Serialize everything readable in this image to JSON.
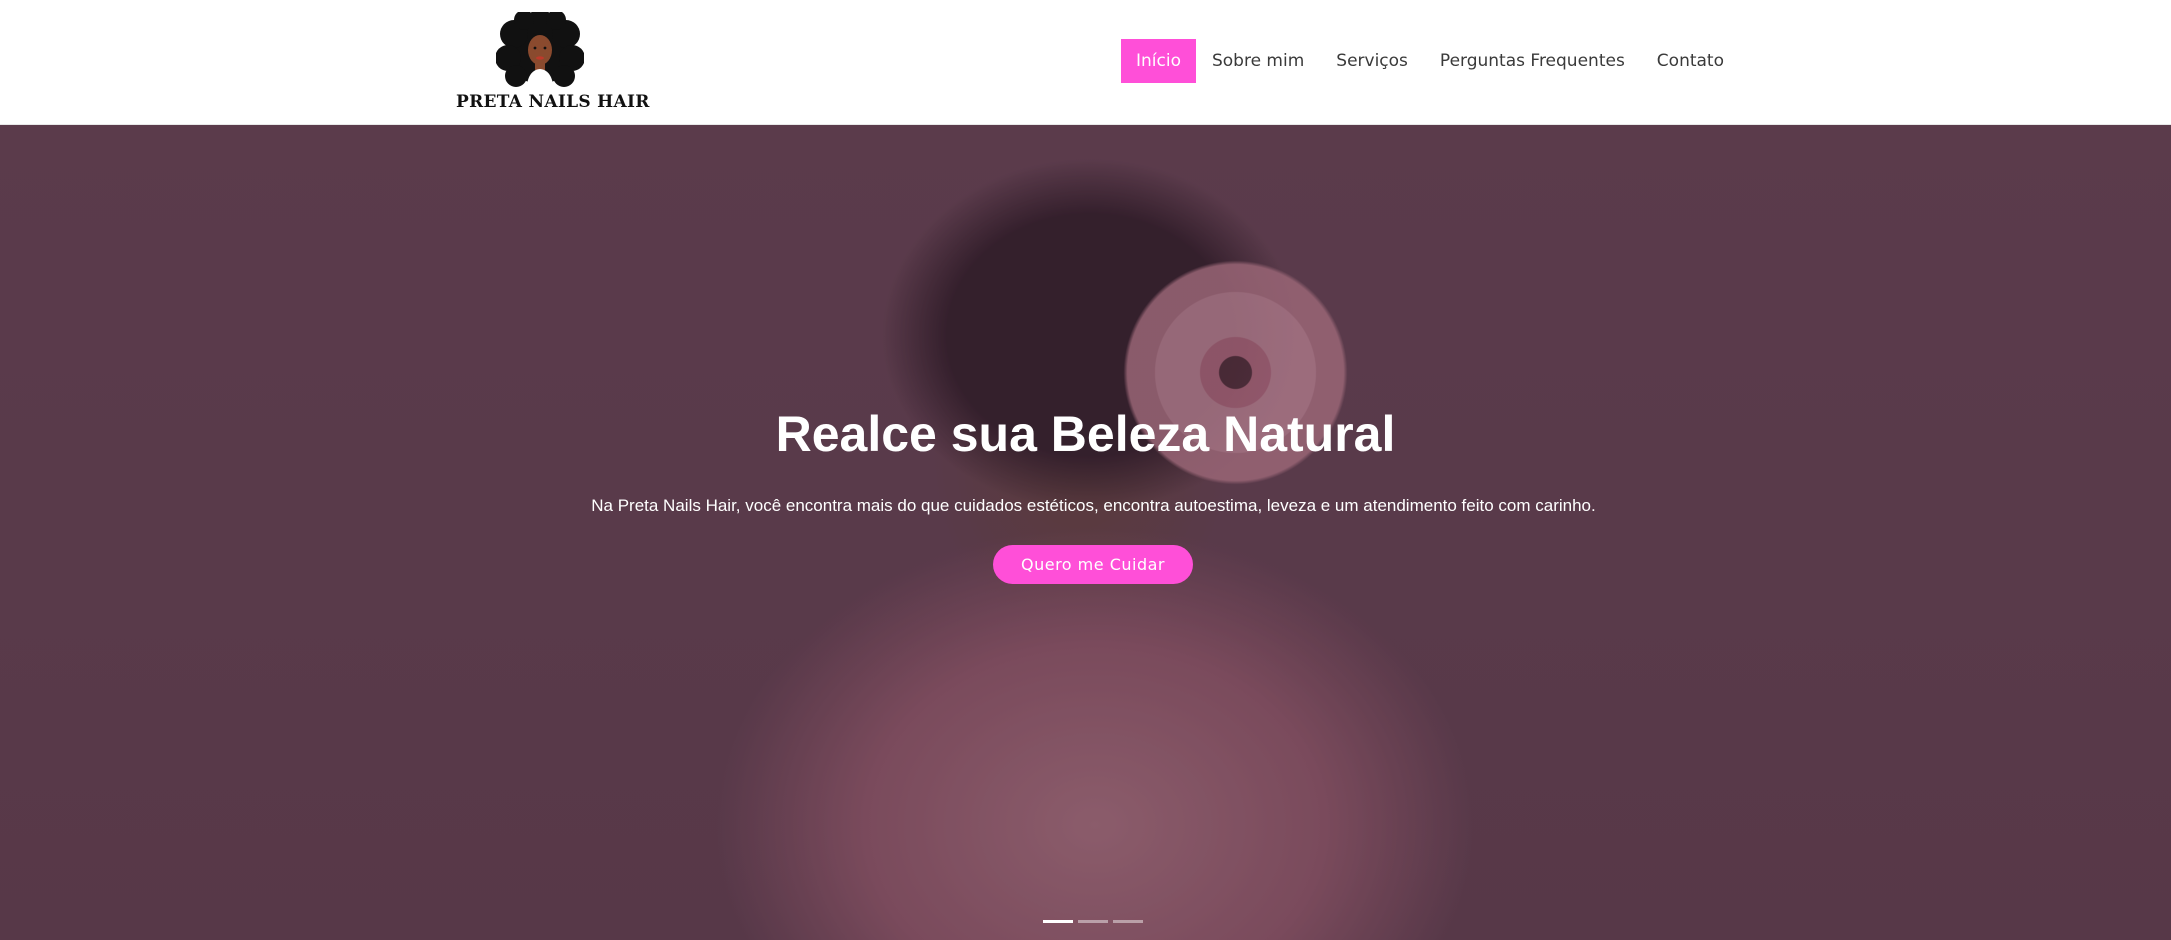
{
  "brand": {
    "name": "PRETA NAILS HAIR",
    "logo_icon": "afro-woman-logo-icon"
  },
  "nav": {
    "items": [
      {
        "label": "Início",
        "active": true
      },
      {
        "label": "Sobre mim",
        "active": false
      },
      {
        "label": "Serviços",
        "active": false
      },
      {
        "label": "Perguntas Frequentes",
        "active": false
      },
      {
        "label": "Contato",
        "active": false
      }
    ]
  },
  "hero": {
    "title": "Realce sua Beleza Natural",
    "subtitle": "Na Preta Nails Hair, você encontra mais do que cuidados estéticos, encontra autoestima, leveza e um atendimento feito com carinho.",
    "cta_label": "Quero me Cuidar",
    "slides": 3,
    "active_slide": 1
  },
  "colors": {
    "accent": "#ff4fd8",
    "text_dark": "#3a3a3a",
    "hero_overlay": "#5c3a4c"
  }
}
